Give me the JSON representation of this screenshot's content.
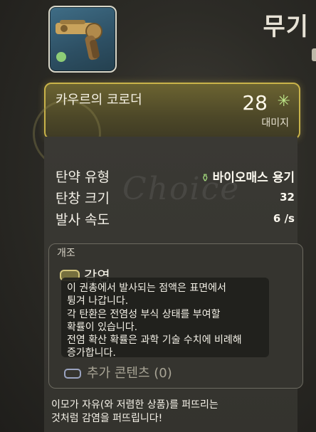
{
  "section_title": "무기",
  "weapon": {
    "name": "카우르의 코로더",
    "damage_value": "28",
    "damage_label": "대미지",
    "damage_icon": "toxin-icon"
  },
  "stats": [
    {
      "label": "탄약 유형",
      "value": "바이오매스 용기",
      "icon": "ammo-canister-icon"
    },
    {
      "label": "탄창 크기",
      "value": "32"
    },
    {
      "label": "발사 속도",
      "value": "6 /s"
    }
  ],
  "watermark": "Choice",
  "mod": {
    "section_label": "개조",
    "name": "감염",
    "tooltip": "이 권총에서 발사되는 점액은 표면에서\n튕겨 나갑니다.\n각 탄환은 전염성 부식 상태를 부여할\n확률이 있습니다.\n전염 확산 확률은 과학 기술 수치에 비례해\n증가합니다.",
    "extra_content": "추가 콘텐츠 (0)"
  },
  "description": "이모가 자유(와 저렴한 상품)를 퍼뜨리는\n것처럼 감염을 퍼뜨립니다!",
  "colors": {
    "accent_gold": "#c9b34a",
    "toxin_green": "#bfe88a"
  }
}
